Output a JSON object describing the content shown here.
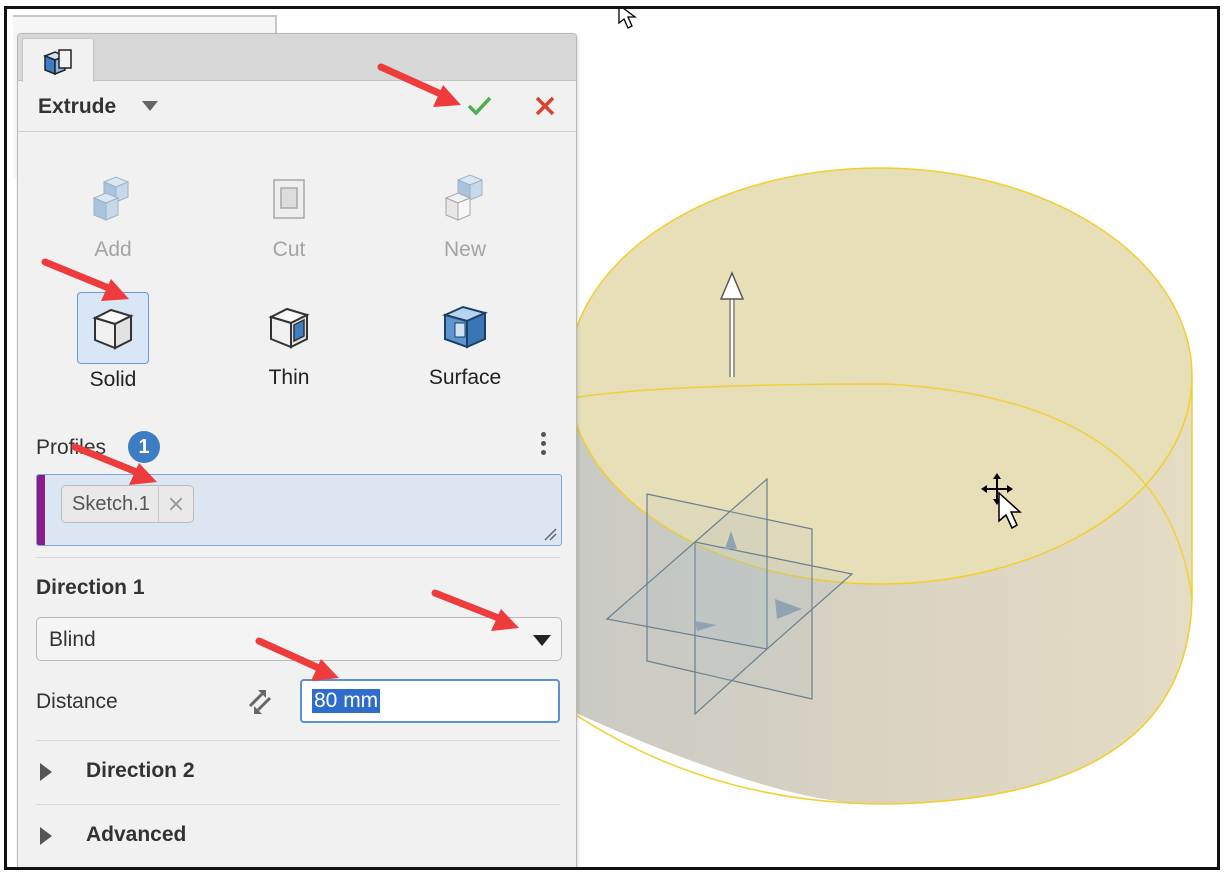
{
  "dialog": {
    "title": "Extrude",
    "accept_icon": "checkmark-icon",
    "cancel_icon": "close-icon",
    "operation_types": [
      {
        "label": "Add",
        "icon": "add-icon",
        "enabled": false
      },
      {
        "label": "Cut",
        "icon": "cut-icon",
        "enabled": false
      },
      {
        "label": "New",
        "icon": "new-icon",
        "enabled": false
      }
    ],
    "body_types": [
      {
        "label": "Solid",
        "icon": "solid-icon",
        "selected": true
      },
      {
        "label": "Thin",
        "icon": "thin-icon",
        "selected": false
      },
      {
        "label": "Surface",
        "icon": "surface-icon",
        "selected": false
      }
    ],
    "profiles": {
      "label": "Profiles",
      "count": "1",
      "items": [
        "Sketch.1"
      ]
    },
    "direction1": {
      "label": "Direction 1",
      "end_condition": "Blind",
      "distance_label": "Distance",
      "distance_value": "80 mm"
    },
    "direction2": {
      "label": "Direction 2",
      "expanded": false
    },
    "advanced": {
      "label": "Advanced",
      "expanded": false
    }
  },
  "colors": {
    "accent": "#3c7dc4",
    "profile_bar": "#8b1a8b",
    "accept": "#4caf50",
    "cancel": "#d9432f",
    "callout_arrow": "#ee3b3b",
    "preview_fill": "#e7dfb8",
    "preview_edge": "#f2cf2e"
  }
}
